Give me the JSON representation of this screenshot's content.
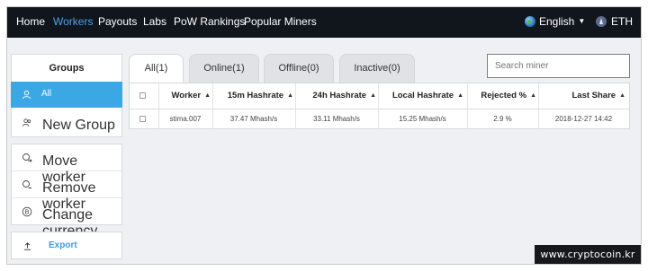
{
  "nav": {
    "items": [
      {
        "label": "Home"
      },
      {
        "label": "Workers"
      },
      {
        "label": "Payouts"
      },
      {
        "label": "Labs"
      },
      {
        "label": "PoW Rankings"
      },
      {
        "label": "Popular Miners"
      }
    ],
    "language": "English",
    "currency": "ETH",
    "active_color": "#4ba3ea"
  },
  "sidebar": {
    "title": "Groups",
    "groups": [
      {
        "label": "All",
        "icon": "user-icon"
      },
      {
        "label": "New Group",
        "icon": "group-icon"
      }
    ],
    "actions": [
      {
        "label": "Move worker",
        "icon": "move-worker-icon"
      },
      {
        "label": "Remove worker",
        "icon": "remove-worker-icon"
      },
      {
        "label": "Change currency",
        "icon": "currency-icon"
      }
    ],
    "export": {
      "label": "Export",
      "icon": "upload-icon"
    },
    "selected_color": "#3ba8e6"
  },
  "tabs": [
    {
      "label": "All(1)"
    },
    {
      "label": "Online(1)"
    },
    {
      "label": "Offline(0)"
    },
    {
      "label": "Inactive(0)"
    }
  ],
  "search": {
    "placeholder": "Search miner"
  },
  "table": {
    "columns": [
      "Worker",
      "15m Hashrate",
      "24h Hashrate",
      "Local Hashrate",
      "Rejected %",
      "Last Share"
    ],
    "rows": [
      [
        "stima.007",
        "37.47 Mhash/s",
        "33.11 Mhash/s",
        "15.25 Mhash/s",
        "2.9 %",
        "2018-12-27 14:42"
      ]
    ]
  },
  "watermark": "www.cryptocoin.kr"
}
